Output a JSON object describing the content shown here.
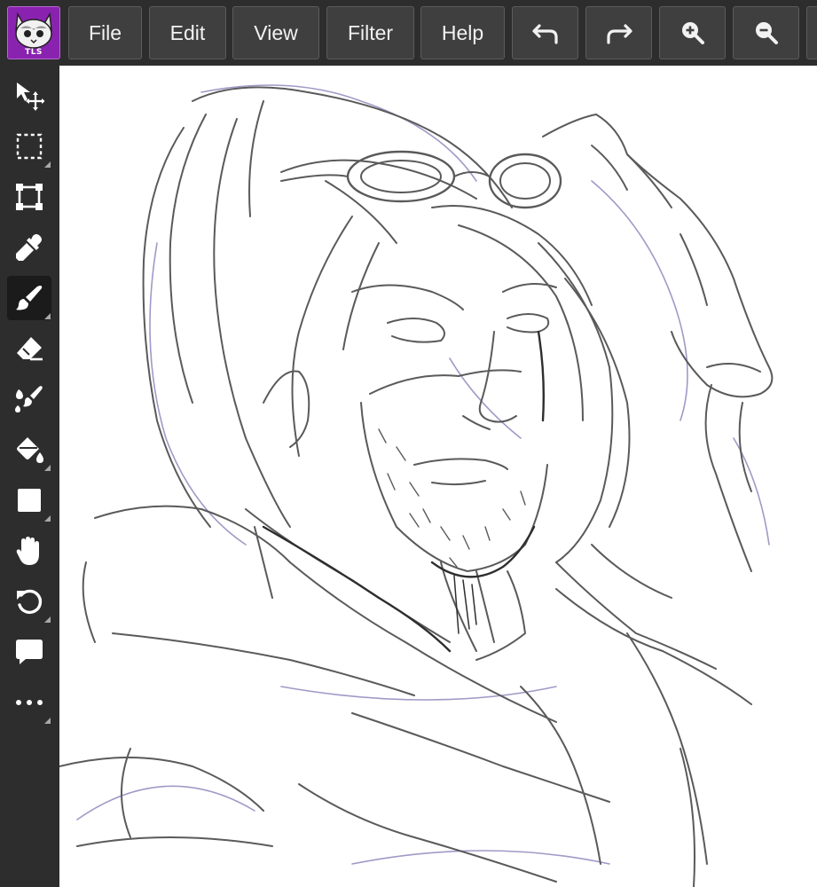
{
  "app": {
    "logo_text": "TLS"
  },
  "menu": {
    "file": "File",
    "edit": "Edit",
    "view": "View",
    "filter": "Filter",
    "help": "Help"
  },
  "toolbar_actions": [
    "undo-icon",
    "redo-icon",
    "zoom-in-icon",
    "zoom-out-icon"
  ],
  "tools": [
    {
      "name": "move-tool",
      "icon": "move-arrow-icon",
      "active": false,
      "has_submenu": false
    },
    {
      "name": "select-tool",
      "icon": "dashed-rect-icon",
      "active": false,
      "has_submenu": true
    },
    {
      "name": "transform-tool",
      "icon": "transform-box-icon",
      "active": false,
      "has_submenu": false
    },
    {
      "name": "eyedropper-tool",
      "icon": "eyedropper-icon",
      "active": false,
      "has_submenu": false
    },
    {
      "name": "brush-tool",
      "icon": "brush-icon",
      "active": true,
      "has_submenu": true
    },
    {
      "name": "eraser-tool",
      "icon": "eraser-icon",
      "active": false,
      "has_submenu": false
    },
    {
      "name": "smudge-tool",
      "icon": "smudge-brush-icon",
      "active": false,
      "has_submenu": false
    },
    {
      "name": "fill-tool",
      "icon": "paint-bucket-icon",
      "active": false,
      "has_submenu": true
    },
    {
      "name": "shape-tool",
      "icon": "square-icon",
      "active": false,
      "has_submenu": true
    },
    {
      "name": "hand-tool",
      "icon": "hand-icon",
      "active": false,
      "has_submenu": false
    },
    {
      "name": "rotate-tool",
      "icon": "rotate-icon",
      "active": false,
      "has_submenu": true
    },
    {
      "name": "text-tool",
      "icon": "speech-bubble-icon",
      "active": false,
      "has_submenu": false
    },
    {
      "name": "more-tools",
      "icon": "more-dots-icon",
      "active": false,
      "has_submenu": true
    }
  ],
  "colors": {
    "toolbar_bg": "#2d2d2d",
    "button_bg": "#3f3f3f",
    "logo_bg": "#8a22b0",
    "sketch_line": "#555555",
    "sketch_purple": "#8a7fb8"
  }
}
